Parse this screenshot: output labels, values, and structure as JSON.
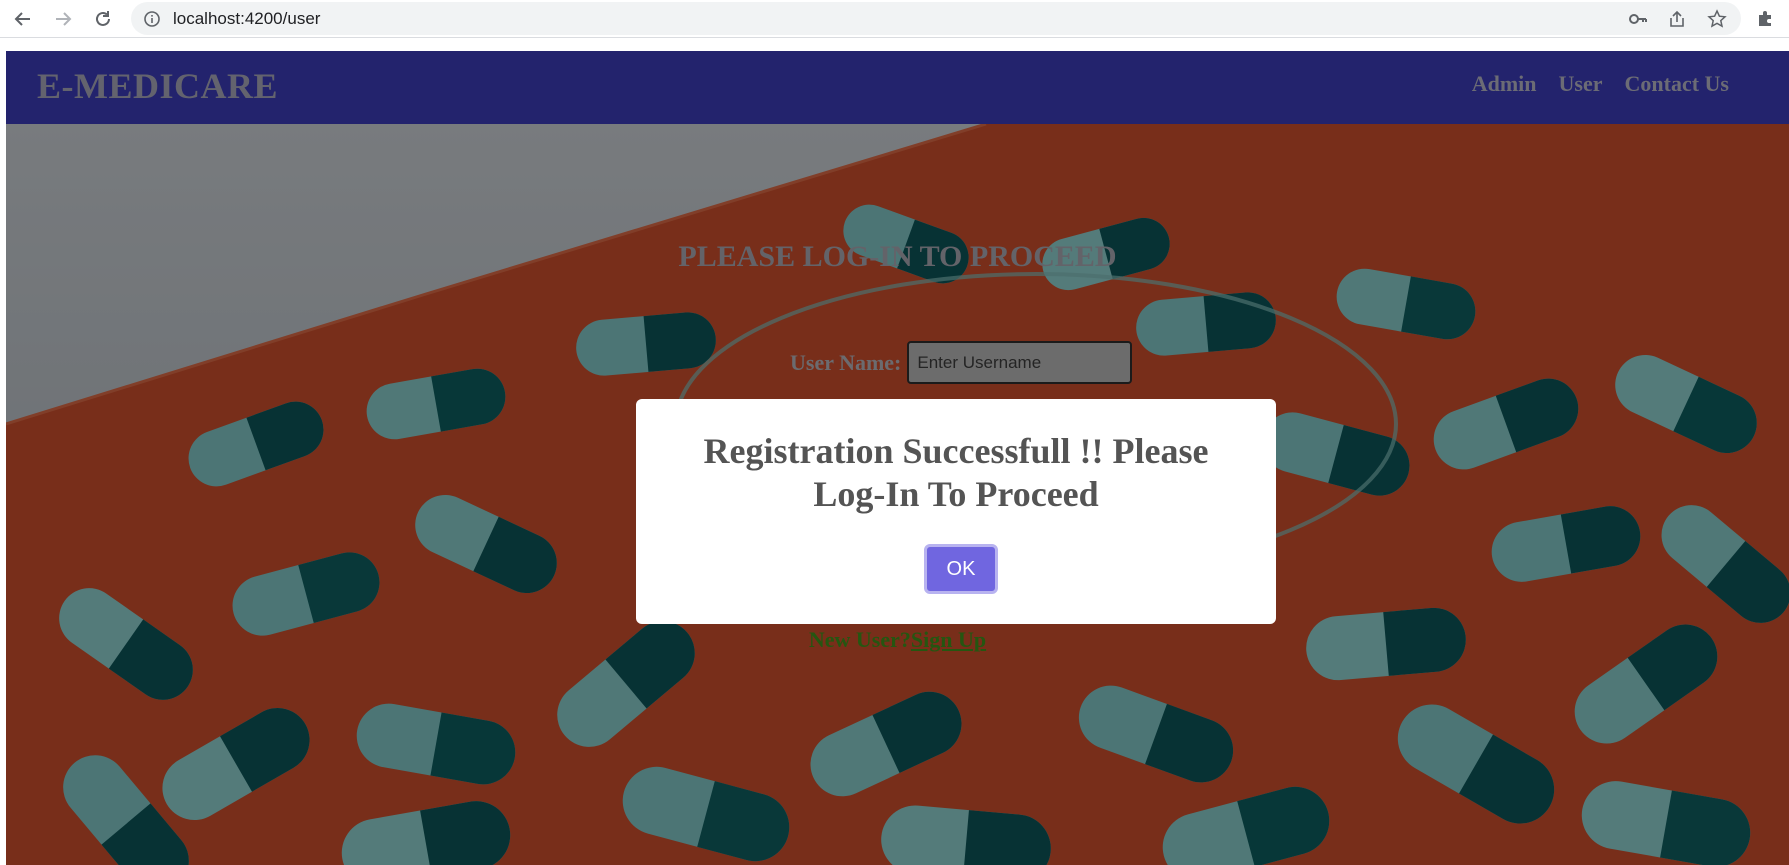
{
  "browser": {
    "url": "localhost:4200/user"
  },
  "app": {
    "brand": "E-MEDICARE",
    "nav": [
      {
        "label": "Admin"
      },
      {
        "label": "User"
      },
      {
        "label": "Contact Us"
      }
    ]
  },
  "login": {
    "title": "PLEASE LOG-IN TO PROCEED",
    "username_label": "User Name:",
    "username_placeholder": "Enter Username",
    "new_user_text": "New User?",
    "signup_label": "Sign Up"
  },
  "dialog": {
    "message": "Registration Successfull !! Please Log-In To Proceed",
    "ok_label": "OK"
  },
  "colors": {
    "navbar": "#3b3bb6",
    "modal_button": "#7066e0",
    "signup_link": "#3f8f1d"
  },
  "icons": [
    "back-arrow-icon",
    "forward-arrow-icon",
    "reload-icon",
    "info-icon",
    "key-icon",
    "share-icon",
    "star-icon",
    "puzzle-extension-icon"
  ]
}
